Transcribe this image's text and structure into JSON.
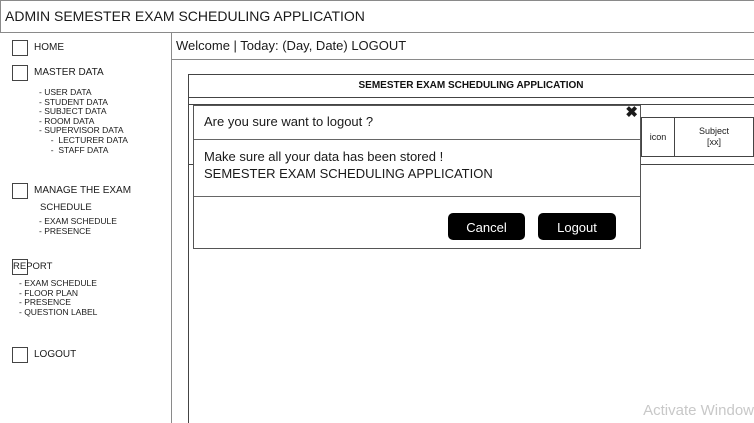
{
  "window": {
    "title": "ADMIN   SEMESTER EXAM SCHEDULING APPLICATION"
  },
  "topbar": {
    "text": "Welcome | Today: (Day, Date)  LOGOUT"
  },
  "sidebar": {
    "home": "HOME",
    "master": {
      "label": "MASTER DATA",
      "items": [
        "- USER DATA",
        "- STUDENT  DATA",
        "- SUBJECT DATA",
        "- ROOM DATA",
        "- SUPERVISOR DATA",
        "     -  LECTURER DATA",
        "     -  STAFF DATA"
      ]
    },
    "manage": {
      "label_line1": "MANAGE THE EXAM",
      "label_line2": "SCHEDULE",
      "items": [
        "- EXAM SCHEDULE",
        "- PRESENCE"
      ]
    },
    "report": {
      "label": "REPORT",
      "items": [
        "- EXAM SCHEDULE",
        "- FLOOR PLAN",
        "- PRESENCE",
        "- QUESTION LABEL"
      ]
    },
    "logout": "LOGOUT"
  },
  "main": {
    "app_title": "SEMESTER EXAM SCHEDULING APPLICATION",
    "columns": {
      "icon": "icon",
      "subject_line1": "Subject",
      "subject_line2": "[xx]"
    }
  },
  "dialog": {
    "title": "Are you sure want to logout ?",
    "close_glyph": "✖",
    "message_line1": "Make sure all your data has been stored !",
    "message_line2": "SEMESTER EXAM SCHEDULING APPLICATION",
    "cancel_label": "Cancel",
    "logout_label": "Logout"
  },
  "watermark": "Activate Window"
}
